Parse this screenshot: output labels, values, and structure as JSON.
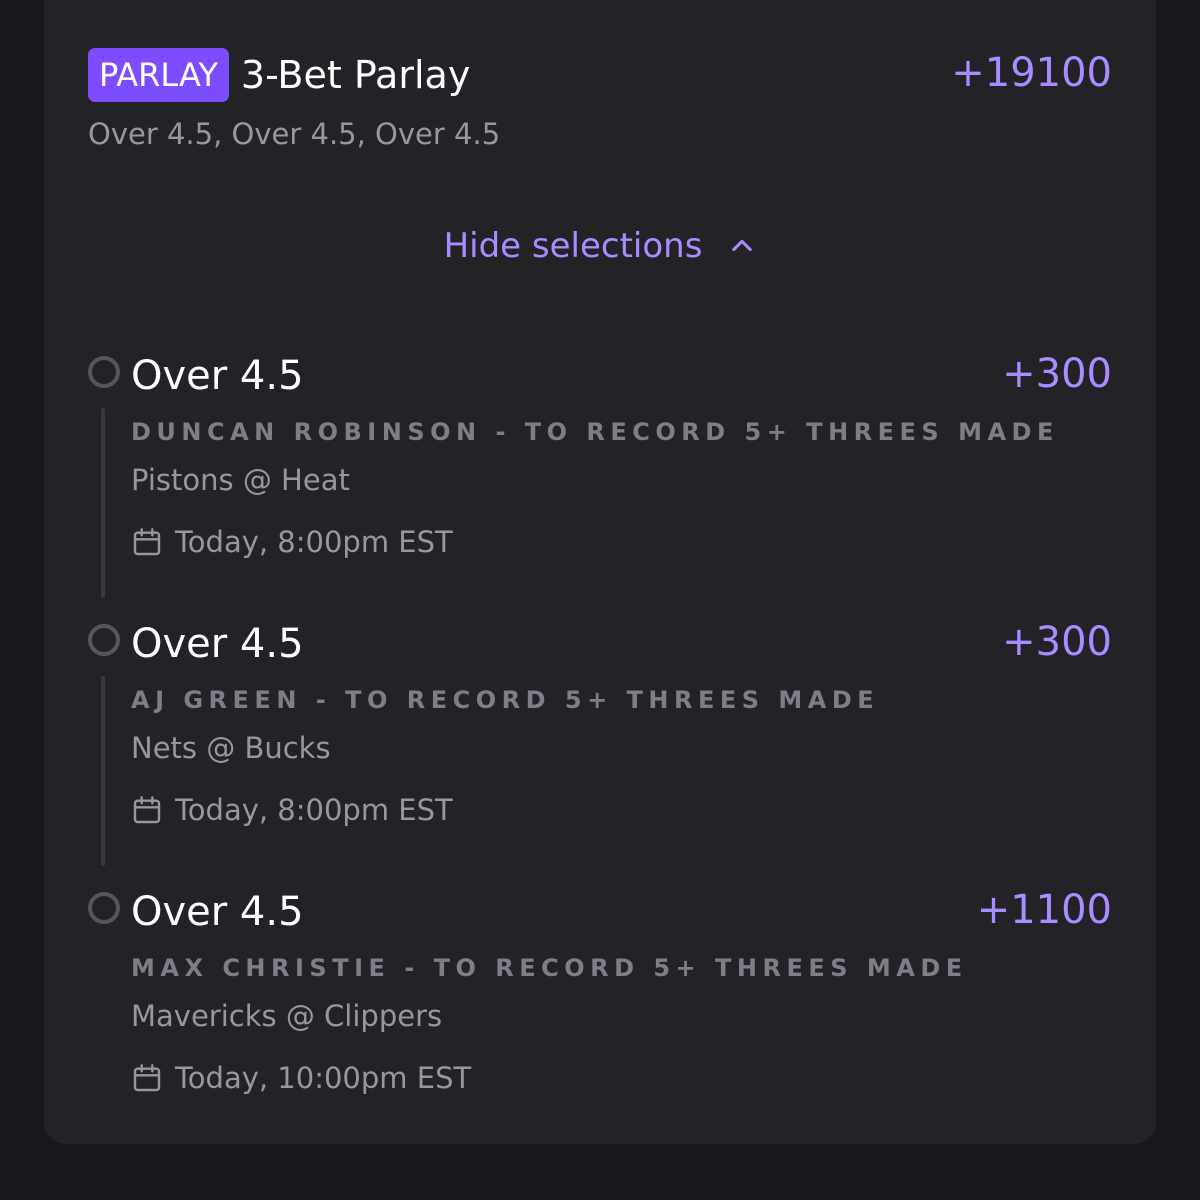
{
  "parlay": {
    "badge": "PARLAY",
    "title": "3-Bet Parlay",
    "odds": "+19100",
    "subtitle": "Over 4.5, Over 4.5, Over 4.5",
    "toggle_label": "Hide selections"
  },
  "selections": [
    {
      "name": "Over 4.5",
      "odds": "+300",
      "market": "DUNCAN ROBINSON - TO RECORD 5+ THREES MADE",
      "game": "Pistons @ Heat",
      "time": "Today, 8:00pm EST"
    },
    {
      "name": "Over 4.5",
      "odds": "+300",
      "market": "AJ GREEN - TO RECORD 5+ THREES MADE",
      "game": "Nets @ Bucks",
      "time": "Today, 8:00pm EST"
    },
    {
      "name": "Over 4.5",
      "odds": "+1100",
      "market": "MAX CHRISTIE - TO RECORD 5+ THREES MADE",
      "game": "Mavericks @ Clippers",
      "time": "Today, 10:00pm EST"
    }
  ],
  "icons": {
    "toggle": "chevron-up-icon",
    "status": "circle-outline-icon",
    "date": "calendar-icon"
  },
  "colors": {
    "accent": "#a98cff",
    "badge": "#7b4dff",
    "card": "#232227",
    "background": "#18171b"
  }
}
